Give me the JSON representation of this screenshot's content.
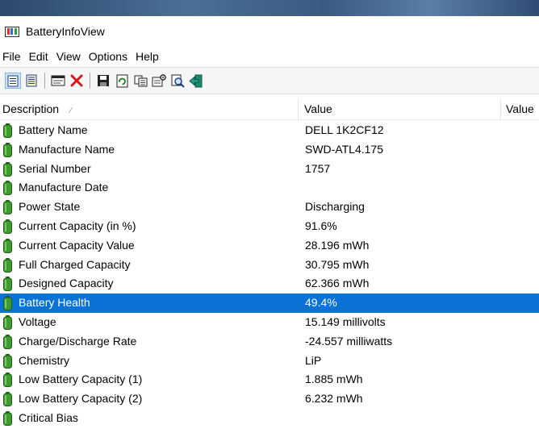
{
  "window": {
    "title": "BatteryInfoView"
  },
  "menu": [
    "File",
    "Edit",
    "View",
    "Options",
    "Help"
  ],
  "toolbar": {
    "buttons": [
      {
        "icon": "properties-view-icon",
        "active": true
      },
      {
        "icon": "list-view-icon"
      },
      {
        "icon": "window-icon"
      },
      {
        "icon": "delete-icon"
      },
      {
        "icon": "save-icon"
      },
      {
        "icon": "refresh-icon"
      },
      {
        "icon": "copy-icon"
      },
      {
        "icon": "properties-icon"
      },
      {
        "icon": "find-icon"
      },
      {
        "icon": "exit-icon"
      }
    ]
  },
  "columns": [
    "Description",
    "Value",
    "Value"
  ],
  "sort_indicator": "∕",
  "colors": {
    "battery_green": "#3f9b2e",
    "selection": "#0a72d4"
  },
  "rows": [
    {
      "description": "Battery Name",
      "value": "DELL 1K2CF12"
    },
    {
      "description": "Manufacture Name",
      "value": "SWD-ATL4.175"
    },
    {
      "description": "Serial Number",
      "value": "1757"
    },
    {
      "description": "Manufacture Date",
      "value": ""
    },
    {
      "description": "Power State",
      "value": "Discharging"
    },
    {
      "description": "Current Capacity (in %)",
      "value": "91.6%"
    },
    {
      "description": "Current Capacity Value",
      "value": "28.196 mWh"
    },
    {
      "description": "Full Charged Capacity",
      "value": "30.795 mWh"
    },
    {
      "description": "Designed Capacity",
      "value": "62.366 mWh"
    },
    {
      "description": "Battery Health",
      "value": "49.4%",
      "selected": true
    },
    {
      "description": "Voltage",
      "value": "15.149 millivolts"
    },
    {
      "description": "Charge/Discharge Rate",
      "value": "-24.557 milliwatts"
    },
    {
      "description": "Chemistry",
      "value": "LiP"
    },
    {
      "description": "Low Battery Capacity (1)",
      "value": "1.885 mWh"
    },
    {
      "description": "Low Battery Capacity (2)",
      "value": "6.232 mWh"
    },
    {
      "description": "Critical Bias",
      "value": ""
    }
  ]
}
